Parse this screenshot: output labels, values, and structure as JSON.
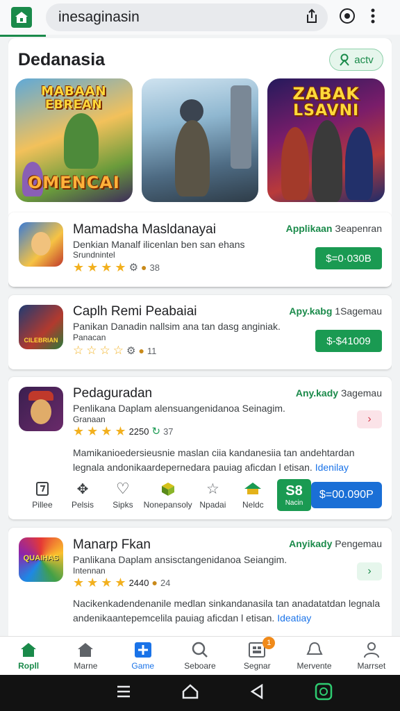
{
  "browser": {
    "url": "inesaginasin"
  },
  "header": {
    "title": "Dedanasia",
    "activ_label": "actv"
  },
  "banners": [
    {
      "title_top": "MABAAN",
      "title_mid": "EBREAN",
      "title_bottom": "OMENCAI"
    },
    {
      "title_top": "",
      "title_mid": "",
      "title_bottom": ""
    },
    {
      "title_top": "ZABAK",
      "title_mid": "LSAVNI",
      "title_bottom": ""
    }
  ],
  "apps": [
    {
      "name": "Mamadsha Masldanayai",
      "type_bold": "Applikaan",
      "type_rest": "Зeapenran",
      "desc": "Denkian Manalf ilicenlan ben san ehans",
      "sub": "Srundnintel",
      "rating_count": "38",
      "price": "$=0·030B"
    },
    {
      "name": "Caplh Remi Peabaiai",
      "type_bold": "Apy.kabg",
      "type_rest": "1Sagemau",
      "desc": "Panikan Danadin nallsim ana tan dasg anginiak.",
      "sub": "Panacan",
      "rating_count": "11",
      "price": "$-$41009",
      "icon_text": "CILEBRIAN"
    },
    {
      "name": "Pedaguradan",
      "type_bold": "Any.kady",
      "type_rest": "Зagemau",
      "desc": "Penlikana Daplam alensuangenidanoa Seinagim.",
      "sub": "Granaan",
      "rating_value": "2250",
      "rating_count": "37",
      "long_desc": "Mamikanioedersieusnie maslan ciia kandanesiia tan andehtardan legnala andonikaardepernedara pauiag aficdan l etisan.",
      "link": "Idenilay",
      "actions": [
        "Pillee",
        "Pelsis",
        "Sipks",
        "Nonepansoly",
        "Npadai",
        "Neldc"
      ],
      "s8_top": "S8",
      "s8_bottom": "Nacin",
      "blue_price": "$=00.090P"
    },
    {
      "name": "Manarp Fkan",
      "type_bold": "Anyikady",
      "type_rest": "Pengemau",
      "desc": "Panlikana Daplam ansisctangenidanoa Seiangim.",
      "sub": "Intennan",
      "rating_value": "2440",
      "rating_count": "24",
      "long_desc": "Nacikenkadendenanile medlan sinkandanasila tan anadatatdan legnala andenikaantepemcelila pauiag aficdan l etisan.",
      "link": "Ideatiay",
      "icon_text": "QUAIHAS"
    }
  ],
  "bottom_nav": [
    {
      "label": "Ropll"
    },
    {
      "label": "Marne"
    },
    {
      "label": "Game"
    },
    {
      "label": "Seboare"
    },
    {
      "label": "Segnar",
      "badge": "1"
    },
    {
      "label": "Mervente"
    },
    {
      "label": "Marrset"
    }
  ],
  "colors": {
    "accent_green": "#1a8a4a",
    "button_green": "#1a9a52",
    "accent_blue": "#1a73e8"
  }
}
